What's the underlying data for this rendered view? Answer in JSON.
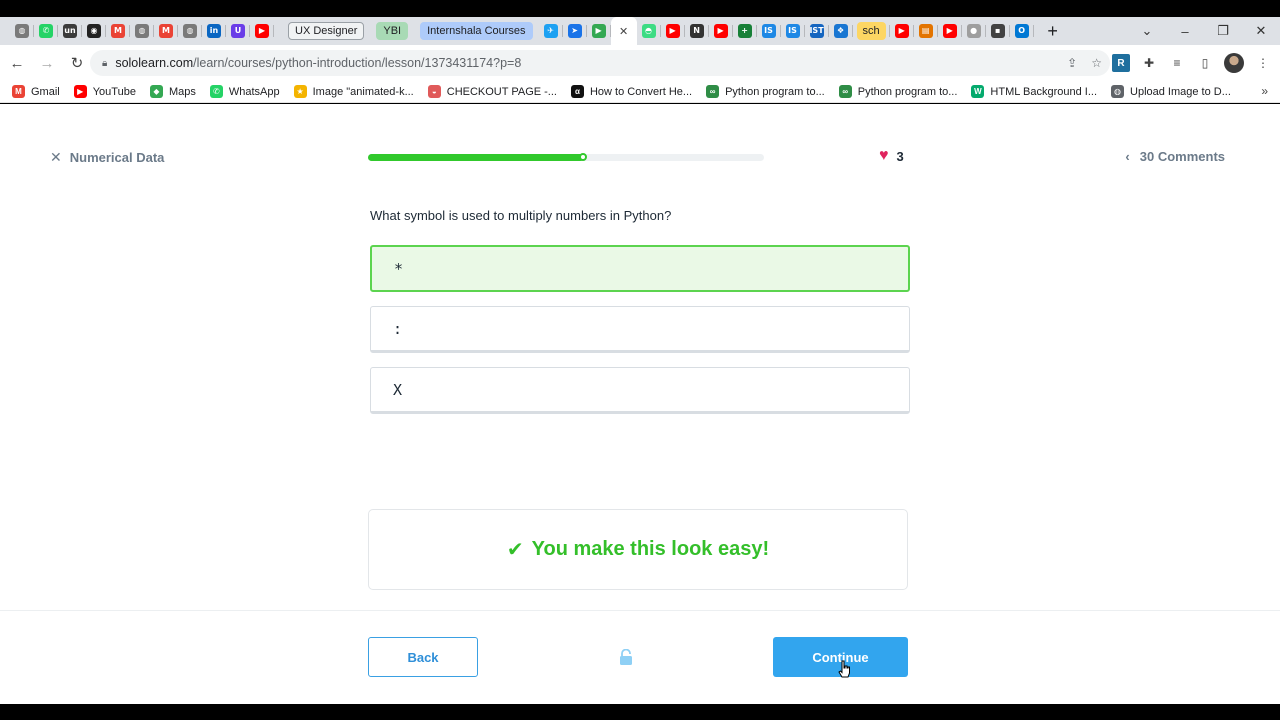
{
  "browser": {
    "tab_icons_left": [
      {
        "name": "globe-icon",
        "color": "#7a7a7a",
        "glyph": "◍"
      },
      {
        "name": "whatsapp-icon",
        "color": "#25d366",
        "glyph": "✆"
      },
      {
        "name": "unstop-icon",
        "color": "#3b3b3b",
        "glyph": "un"
      },
      {
        "name": "github-icon",
        "color": "#222222",
        "glyph": "◉"
      },
      {
        "name": "gmail-icon",
        "color": "#ea4335",
        "glyph": "M"
      },
      {
        "name": "globe-icon",
        "color": "#7a7a7a",
        "glyph": "◍"
      },
      {
        "name": "gmail-icon",
        "color": "#ea4335",
        "glyph": "M"
      },
      {
        "name": "globe-icon",
        "color": "#7a7a7a",
        "glyph": "◍"
      },
      {
        "name": "linkedin-icon",
        "color": "#0a66c2",
        "glyph": "in"
      },
      {
        "name": "unacademy-icon",
        "color": "#6a3de8",
        "glyph": "U"
      },
      {
        "name": "youtube-icon",
        "color": "#ff0000",
        "glyph": "▶"
      }
    ],
    "tab_groups": [
      {
        "label": "UX Designer",
        "color": "#f1f3f4",
        "border": "#9aa0a6"
      },
      {
        "label": "YBI",
        "color": "#a8dab5",
        "border": "#a8dab5"
      },
      {
        "label": "Internshala Courses",
        "color": "#aecbfa",
        "border": "#aecbfa"
      }
    ],
    "tab_icons_right": [
      {
        "name": "twitter-icon",
        "color": "#1da1f2",
        "glyph": "✈"
      },
      {
        "name": "send-icon",
        "color": "#1a73e8",
        "glyph": "➤"
      },
      {
        "name": "play-store-icon",
        "color": "#34a853",
        "glyph": "▶"
      },
      {
        "name": "close-tab-icon",
        "color": "#444444",
        "glyph": "✕",
        "active": true
      },
      {
        "name": "android-icon",
        "color": "#3ddc84",
        "glyph": "◓"
      },
      {
        "name": "youtube-icon",
        "color": "#ff0000",
        "glyph": "▶"
      },
      {
        "name": "notion-icon",
        "color": "#333333",
        "glyph": "N"
      },
      {
        "name": "youtube-icon",
        "color": "#ff0000",
        "glyph": "▶"
      },
      {
        "name": "plus-icon",
        "color": "#188038",
        "glyph": "+"
      },
      {
        "name": "is-icon",
        "color": "#1e88e5",
        "glyph": "IS"
      },
      {
        "name": "is-icon",
        "color": "#1e88e5",
        "glyph": "IS"
      },
      {
        "name": "ist-icon",
        "color": "#1565c0",
        "glyph": "IST"
      },
      {
        "name": "network-icon",
        "color": "#1976d2",
        "glyph": "❖"
      },
      {
        "name": "sch-group",
        "color": "#fdd663",
        "glyph": "sch",
        "pill": true
      },
      {
        "name": "youtube-icon",
        "color": "#ff0000",
        "glyph": "▶"
      },
      {
        "name": "chart-icon",
        "color": "#e37400",
        "glyph": "▤"
      },
      {
        "name": "youtube-icon",
        "color": "#ff0000",
        "glyph": "▶"
      },
      {
        "name": "circle-icon",
        "color": "#9e9e9e",
        "glyph": "●"
      },
      {
        "name": "doc-icon",
        "color": "#424242",
        "glyph": "▪"
      },
      {
        "name": "outlook-icon",
        "color": "#0078d4",
        "glyph": "O"
      }
    ],
    "url_host": "sololearn.com",
    "url_path": "/learn/courses/python-introduction/lesson/1373431174?p=8",
    "bookmarks": [
      {
        "label": "Gmail",
        "icon": "gmail-icon",
        "color": "#ea4335",
        "glyph": "M"
      },
      {
        "label": "YouTube",
        "icon": "youtube-icon",
        "color": "#ff0000",
        "glyph": "▶"
      },
      {
        "label": "Maps",
        "icon": "maps-icon",
        "color": "#34a853",
        "glyph": "⬥"
      },
      {
        "label": "WhatsApp",
        "icon": "whatsapp-icon",
        "color": "#25d366",
        "glyph": "✆"
      },
      {
        "label": "Image \"animated-k...",
        "icon": "star-icon",
        "color": "#f4b400",
        "glyph": "★"
      },
      {
        "label": "CHECKOUT PAGE -...",
        "icon": "lips-icon",
        "color": "#e05a5a",
        "glyph": "◒"
      },
      {
        "label": "How to Convert He...",
        "icon": "alpha-icon",
        "color": "#111111",
        "glyph": "α"
      },
      {
        "label": "Python program to...",
        "icon": "gfg-icon",
        "color": "#2f8d46",
        "glyph": "∞"
      },
      {
        "label": "Python program to...",
        "icon": "gfg-icon",
        "color": "#2f8d46",
        "glyph": "∞"
      },
      {
        "label": "HTML Background I...",
        "icon": "w3-icon",
        "color": "#04aa6d",
        "glyph": "W"
      },
      {
        "label": "Upload Image to D...",
        "icon": "globe-icon",
        "color": "#5f6368",
        "glyph": "◍"
      }
    ]
  },
  "lesson": {
    "title": "Numerical Data",
    "progress": 0.545,
    "hearts": "3",
    "comments": "30 Comments",
    "question": "What symbol is used to multiply numbers in Python?",
    "options": [
      {
        "label": "*",
        "state": "correct"
      },
      {
        "label": ":",
        "state": "default"
      },
      {
        "label": "X",
        "state": "default"
      }
    ],
    "feedback": "You make this look easy!",
    "back_label": "Back",
    "continue_label": "Continue"
  },
  "colors": {
    "accent": "#32a5ee",
    "success": "#34bf2a",
    "heart": "#e0245e"
  }
}
